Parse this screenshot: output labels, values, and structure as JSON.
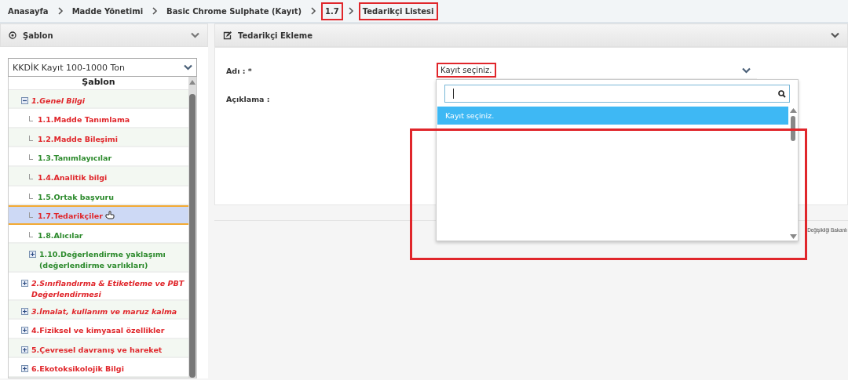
{
  "breadcrumb": [
    {
      "label": "Anasayfa",
      "highlighted": false
    },
    {
      "label": "Madde Yönetimi",
      "highlighted": false
    },
    {
      "label": "Basic Chrome Sulphate (Kayıt)",
      "highlighted": false
    },
    {
      "label": "1.7",
      "highlighted": true
    },
    {
      "label": "Tedarikçi Listesi",
      "highlighted": true
    }
  ],
  "left_panel": {
    "title": "Şablon",
    "template_select": "KKDİK Kayıt 100-1000 Ton",
    "tree_title": "Şablon",
    "tree": [
      {
        "label": "1.Genel Bilgi",
        "color": "#e0262b",
        "italic": true,
        "expanded": true,
        "selected": false,
        "children": [
          {
            "label": "1.1.Madde Tanımlama",
            "color": "#e0262b",
            "selected": false
          },
          {
            "label": "1.2.Madde Bileşimi",
            "color": "#e0262b",
            "selected": false
          },
          {
            "label": "1.3.Tanımlayıcılar",
            "color": "#2c8a2c",
            "selected": false
          },
          {
            "label": "1.4.Analitik bilgi",
            "color": "#e0262b",
            "selected": false
          },
          {
            "label": "1.5.Ortak başvuru",
            "color": "#2c8a2c",
            "selected": false
          },
          {
            "label": "1.7.Tedarikçiler",
            "color": "#e0262b",
            "selected": true
          },
          {
            "label": "1.8.Alıcılar",
            "color": "#2c8a2c",
            "selected": false
          },
          {
            "label": "1.10.Değerlendirme yaklaşımı (değerlendirme varlıkları)",
            "color": "#2c8a2c",
            "selected": false,
            "expanded": false
          }
        ]
      },
      {
        "label": "2.Sınıflandırma & Etiketleme ve PBT Değerlendirmesi",
        "color": "#e0262b",
        "italic": true,
        "expanded": false,
        "selected": false
      },
      {
        "label": "3.İmalat, kullanım ve maruz kalma",
        "color": "#e0262b",
        "italic": true,
        "expanded": false,
        "selected": false
      },
      {
        "label": "4.Fiziksel ve kimyasal özellikler",
        "color": "#e0262b",
        "italic": false,
        "expanded": false,
        "selected": false
      },
      {
        "label": "5.Çevresel davranış ve hareket",
        "color": "#e0262b",
        "italic": false,
        "expanded": false,
        "selected": false
      },
      {
        "label": "6.Ekotoksikolojik Bilgi",
        "color": "#e0262b",
        "italic": false,
        "expanded": false,
        "selected": false
      }
    ]
  },
  "right_panel": {
    "title": "Tedarikçi Ekleme",
    "fields": [
      {
        "label": "Adı : *"
      },
      {
        "label": "Açıklama :"
      }
    ],
    "name_select": {
      "value": "Kayıt seçiniz.",
      "highlighted": true,
      "expanded": true,
      "options": [
        {
          "label": "Kayıt seçiniz.",
          "selected": true
        }
      ],
      "list_highlighted": true
    },
    "footer_text": "Değişikliği Bakanlı"
  }
}
